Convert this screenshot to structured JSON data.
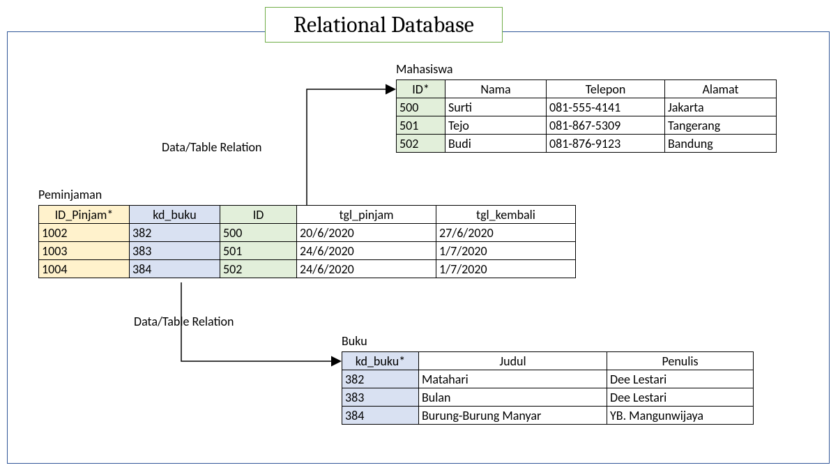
{
  "title": "Relational Database",
  "relation_label_1": "Data/Table Relation",
  "relation_label_2": "Data/Table Relation",
  "mahasiswa": {
    "caption": "Mahasiswa",
    "headers": [
      "ID*",
      "Nama",
      "Telepon",
      "Alamat"
    ],
    "rows": [
      [
        "500",
        "Surti",
        "081-555-4141",
        "Jakarta"
      ],
      [
        "501",
        "Tejo",
        "081-867-5309",
        "Tangerang"
      ],
      [
        "502",
        "Budi",
        "081-876-9123",
        "Bandung"
      ]
    ]
  },
  "peminjaman": {
    "caption": "Peminjaman",
    "headers": [
      "ID_Pinjam*",
      "kd_buku",
      "ID",
      "tgl_pinjam",
      "tgl_kembali"
    ],
    "rows": [
      [
        "1002",
        "382",
        "500",
        "20/6/2020",
        "27/6/2020"
      ],
      [
        "1003",
        "383",
        "501",
        "24/6/2020",
        "1/7/2020"
      ],
      [
        "1004",
        "384",
        "502",
        "24/6/2020",
        "1/7/2020"
      ]
    ]
  },
  "buku": {
    "caption": "Buku",
    "headers": [
      "kd_buku*",
      "Judul",
      "Penulis"
    ],
    "rows": [
      [
        "382",
        "Matahari",
        "Dee Lestari"
      ],
      [
        "383",
        "Bulan",
        "Dee Lestari"
      ],
      [
        "384",
        "Burung-Burung Manyar",
        "YB. Mangunwijaya"
      ]
    ]
  }
}
